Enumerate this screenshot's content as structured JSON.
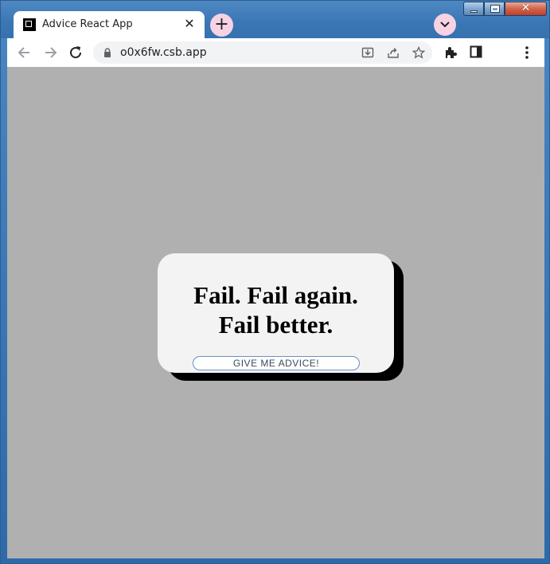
{
  "browser": {
    "tab": {
      "title": "Advice React App",
      "close_glyph": "✕",
      "favicon": "square-logo-icon"
    },
    "new_tab_glyph": "+",
    "tab_search_icon": "chevron-down-icon",
    "window_controls": {
      "close_glyph": "✕"
    },
    "toolbar": {
      "back_icon": "arrow-left-icon",
      "forward_icon": "arrow-right-icon",
      "reload_icon": "reload-icon",
      "lock_icon": "lock-icon",
      "url": "o0x6fw.csb.app",
      "install_icon": "install-icon",
      "share_icon": "share-icon",
      "bookmark_icon": "star-icon",
      "extensions_icon": "puzzle-icon",
      "sidepanel_icon": "side-panel-icon",
      "menu_icon": "kebab-menu-icon"
    }
  },
  "page": {
    "background": "#b0b0b0",
    "card": {
      "advice": "Fail. Fail again. Fail better.",
      "button_label": "GIVE ME ADVICE!",
      "background": "#f3f3f3",
      "shadow_color": "#000000"
    }
  }
}
